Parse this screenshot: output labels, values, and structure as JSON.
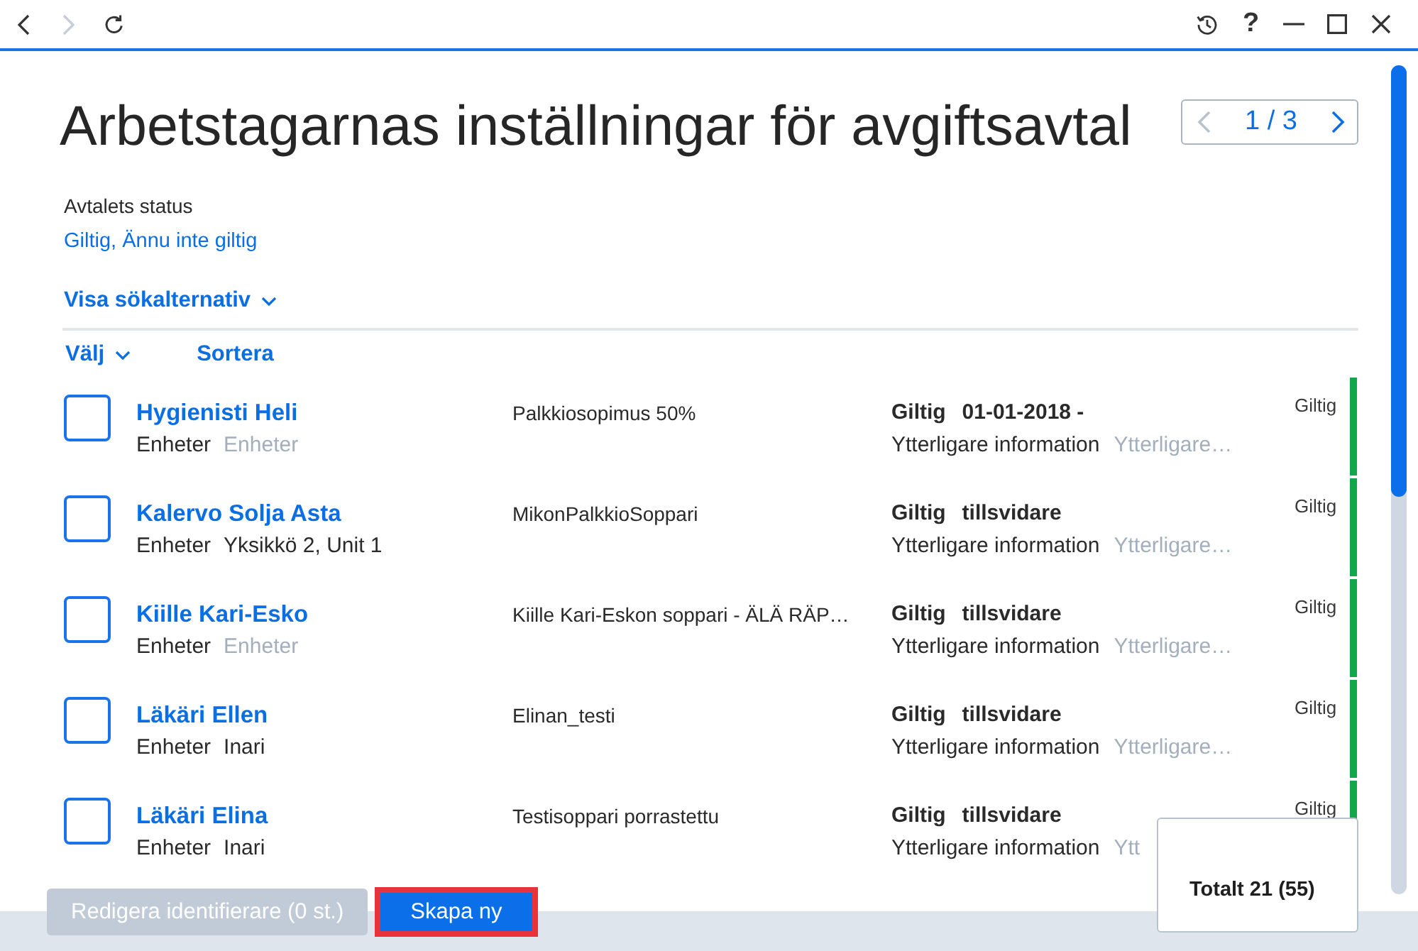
{
  "toolbar": {
    "nav": [
      {
        "kind": "back",
        "disabled": false
      },
      {
        "kind": "forward",
        "disabled": true
      },
      {
        "kind": "refresh",
        "disabled": false
      }
    ],
    "window_controls": [
      {
        "kind": "history"
      },
      {
        "kind": "help",
        "glyph": "?"
      },
      {
        "kind": "minimize"
      },
      {
        "kind": "maximize"
      },
      {
        "kind": "close"
      }
    ]
  },
  "header": {
    "title": "Arbetstagarnas inställningar för avgiftsavtal",
    "pager": {
      "text": "1 / 3",
      "prev_disabled": true,
      "next_disabled": false
    }
  },
  "filter": {
    "label": "Avtalets status",
    "value": "Giltig, Ännu inte giltig",
    "toggle": "Visa sökalternativ"
  },
  "list_toolbar": {
    "select": "Välj",
    "sort": "Sortera"
  },
  "rows": [
    {
      "checked": false,
      "name": "Hygienisti Heli",
      "units_label": "Enheter",
      "units_value": "Enheter",
      "units_muted": true,
      "description": "Palkkiosopimus 50%",
      "status": "Giltig",
      "validity": "01-01-2018 -",
      "info_label": "Ytterligare information",
      "info_value": "Ytterligare…",
      "state": "Giltig",
      "color": "#12a84a"
    },
    {
      "checked": false,
      "name": "Kalervo Solja Asta",
      "units_label": "Enheter",
      "units_value": "Yksikkö 2, Unit 1",
      "units_muted": false,
      "description": "MikonPalkkioSoppari",
      "status": "Giltig",
      "validity": "tillsvidare",
      "info_label": "Ytterligare information",
      "info_value": "Ytterligare…",
      "state": "Giltig",
      "color": "#12a84a"
    },
    {
      "checked": false,
      "name": "Kiille Kari-Esko",
      "units_label": "Enheter",
      "units_value": "Enheter",
      "units_muted": true,
      "description": "Kiille Kari-Eskon soppari - ÄLÄ RÄP…",
      "status": "Giltig",
      "validity": "tillsvidare",
      "info_label": "Ytterligare information",
      "info_value": "Ytterligare…",
      "state": "Giltig",
      "color": "#12a84a"
    },
    {
      "checked": false,
      "name": "Läkäri Ellen",
      "units_label": "Enheter",
      "units_value": "Inari",
      "units_muted": false,
      "description": "Elinan_testi",
      "status": "Giltig",
      "validity": "tillsvidare",
      "info_label": "Ytterligare information",
      "info_value": "Ytterligare…",
      "state": "Giltig",
      "color": "#12a84a"
    },
    {
      "checked": false,
      "name": "Läkäri Elina",
      "units_label": "Enheter",
      "units_value": "Inari",
      "units_muted": false,
      "description": "Testisoppari porrastettu",
      "status": "Giltig",
      "validity": "tillsvidare",
      "info_label": "Ytterligare information",
      "info_value": "Ytt",
      "state": "Giltig",
      "color": "#12a84a"
    }
  ],
  "footer": {
    "buttons": [
      {
        "label": "Redigera identifierare (0 st.)",
        "disabled": true,
        "highlighted": false
      },
      {
        "label": "Skapa ny",
        "disabled": false,
        "highlighted": true
      }
    ],
    "total": "Totalt 21 (55)"
  }
}
